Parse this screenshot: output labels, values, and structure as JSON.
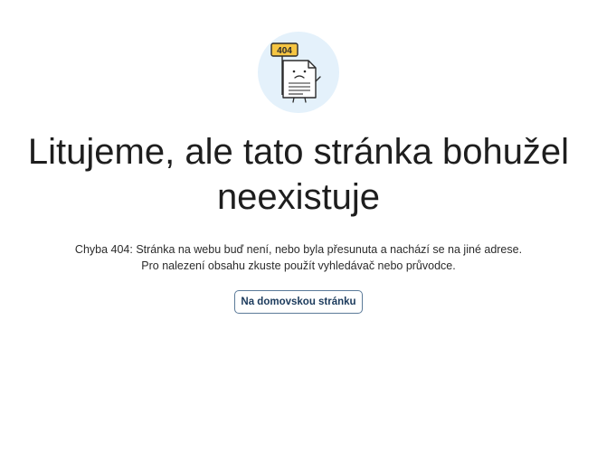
{
  "illustration": {
    "icon": "page-not-found-404-icon",
    "sign_text": "404",
    "circle_color": "#e4f1fb",
    "sign_color": "#f5c542"
  },
  "headline": "Litujeme, ale tato stránka bohužel neexistuje",
  "description": {
    "line1": "Chyba 404: Stránka na webu buď není, nebo byla přesunuta a nachází se na jiné adrese.",
    "line2": "Pro nalezení obsahu zkuste použít vyhledávač nebo průvodce."
  },
  "home_button": {
    "label": "Na domovskou stránku",
    "border_color": "#5b7a99",
    "text_color": "#1b3a5c"
  }
}
